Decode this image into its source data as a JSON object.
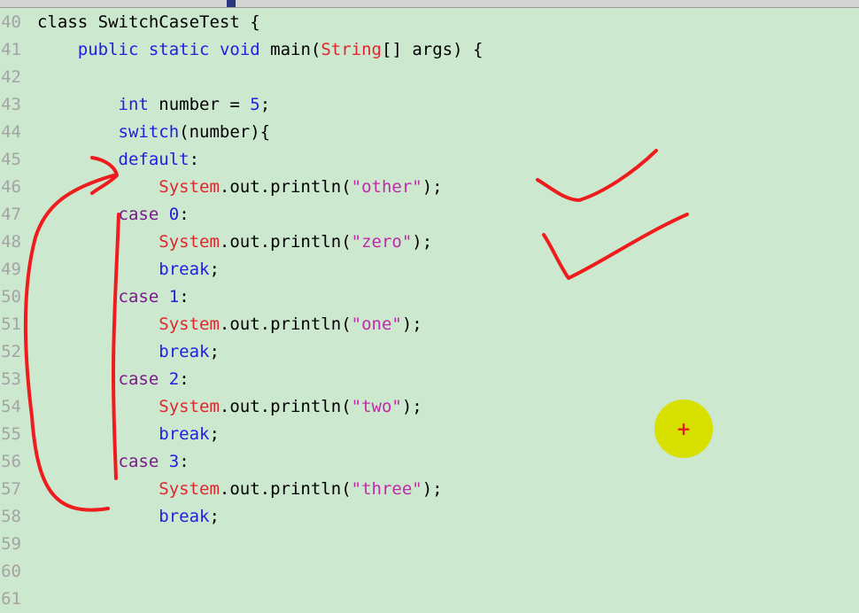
{
  "editor": {
    "lines": [
      {
        "num": "40",
        "text": "class SwitchCaseTest {"
      },
      {
        "num": "41",
        "text": "    public static void main(String[] args) {"
      },
      {
        "num": "42",
        "text": ""
      },
      {
        "num": "43",
        "text": "        int number = 5;"
      },
      {
        "num": "44",
        "text": "        switch(number){"
      },
      {
        "num": "45",
        "text": "        default:"
      },
      {
        "num": "46",
        "text": "            System.out.println(\"other\");"
      },
      {
        "num": "47",
        "text": "        case 0:"
      },
      {
        "num": "48",
        "text": "            System.out.println(\"zero\");"
      },
      {
        "num": "49",
        "text": "            break;"
      },
      {
        "num": "50",
        "text": "        case 1:"
      },
      {
        "num": "51",
        "text": "            System.out.println(\"one\");"
      },
      {
        "num": "52",
        "text": "            break;"
      },
      {
        "num": "53",
        "text": "        case 2:"
      },
      {
        "num": "54",
        "text": "            System.out.println(\"two\");"
      },
      {
        "num": "55",
        "text": "            break;"
      },
      {
        "num": "56",
        "text": "        case 3:"
      },
      {
        "num": "57",
        "text": "            System.out.println(\"three\");"
      },
      {
        "num": "58",
        "text": "            break;"
      },
      {
        "num": "59",
        "text": ""
      },
      {
        "num": "60",
        "text": ""
      },
      {
        "num": "61",
        "text": ""
      }
    ]
  },
  "cursor": {
    "glyph": "+"
  },
  "colors": {
    "background": "#cce8cf",
    "keyword": "#1f1fe0",
    "type": "#e0262d",
    "string": "#c02aa8",
    "annotation_ink": "#ee1c1c",
    "cursor_highlight": "#d8e000"
  }
}
